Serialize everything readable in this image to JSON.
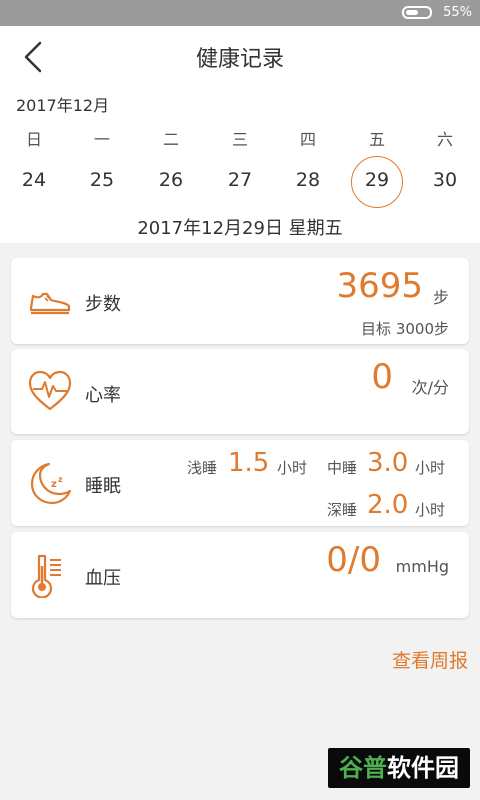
{
  "status": {
    "battery": "55%"
  },
  "header": {
    "title": "健康记录"
  },
  "calendar": {
    "month": "2017年12月",
    "weekdays": [
      "日",
      "一",
      "二",
      "三",
      "四",
      "五",
      "六"
    ],
    "dates": [
      "24",
      "25",
      "26",
      "27",
      "28",
      "29",
      "30"
    ],
    "selected_index": 5,
    "full_date": "2017年12月29日 星期五"
  },
  "cards": {
    "steps": {
      "label": "步数",
      "value": "3695",
      "unit": "步",
      "goal": "目标 3000步"
    },
    "heart": {
      "label": "心率",
      "value": "0",
      "unit": "次/分"
    },
    "sleep": {
      "label": "睡眠",
      "light_label": "浅睡",
      "light_value": "1.5",
      "light_unit": "小时",
      "mid_label": "中睡",
      "mid_value": "3.0",
      "mid_unit": "小时",
      "deep_label": "深睡",
      "deep_value": "2.0",
      "deep_unit": "小时"
    },
    "bp": {
      "label": "血压",
      "value": "0/0",
      "unit": "mmHg"
    }
  },
  "footer": {
    "weekly_link": "查看周报"
  },
  "watermark": {
    "text_green": "谷普",
    "text_white": "软件园"
  },
  "colors": {
    "accent": "#e07a2e",
    "statusbar": "#9b9b9b",
    "background": "#f2f2f2"
  }
}
